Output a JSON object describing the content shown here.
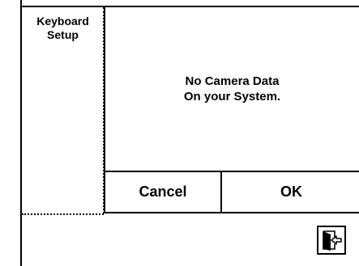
{
  "sidebar": {
    "title_line1": "Keyboard",
    "title_line2": "Setup"
  },
  "dialog": {
    "message_line1": "No Camera Data",
    "message_line2": "On your System.",
    "cancel_label": "Cancel",
    "ok_label": "OK"
  },
  "footer": {
    "exit_icon": "exit-door-icon"
  },
  "colors": {
    "foreground": "#000000",
    "background": "#ffffff"
  }
}
